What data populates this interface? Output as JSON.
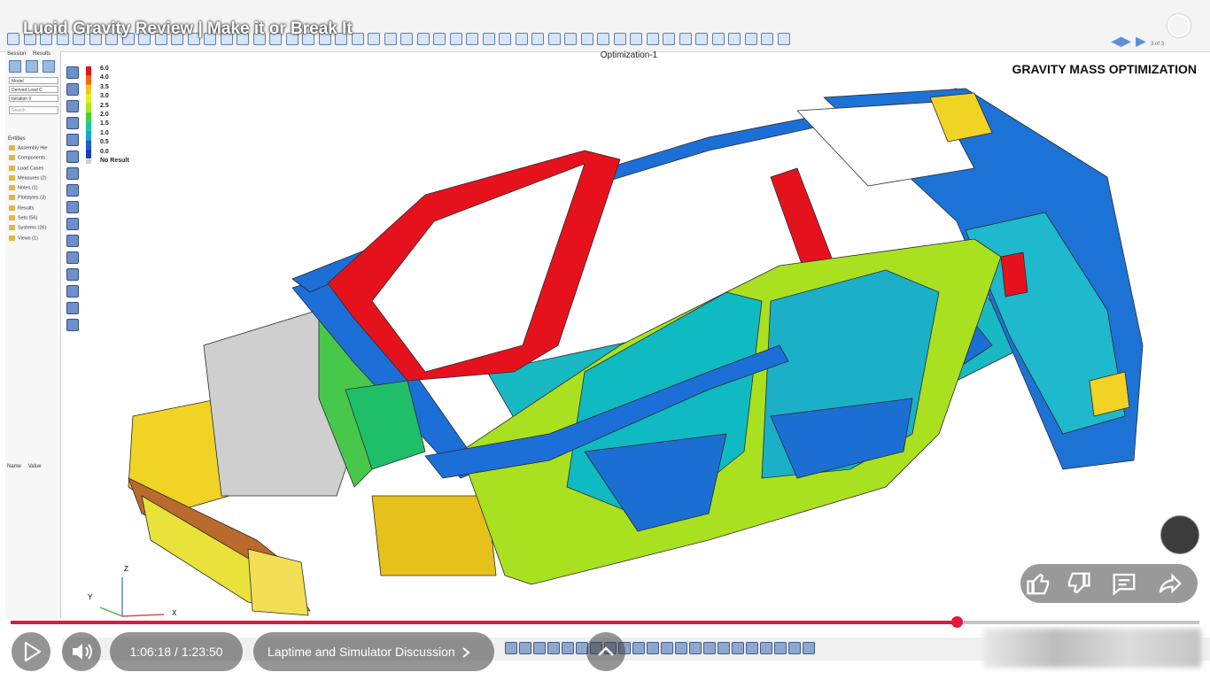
{
  "video": {
    "title": "Lucid Gravity Review | Make it or Break It",
    "current_time": "1:06:18",
    "time_separator": " / ",
    "duration": "1:23:50",
    "chapter": "Laptime and Simulator Discussion",
    "progress_fraction": 0.796,
    "accent_color": "#e4173b"
  },
  "app": {
    "viewport_title": "Optimization-1",
    "heading": "GRAVITY MASS OPTIMIZATION",
    "panel": {
      "tabs": [
        "Session",
        "Results"
      ],
      "dropdowns": [
        "Model",
        "Derived Load C",
        "Iteration 0"
      ],
      "search_placeholder": "Search",
      "entities_label": "Entities",
      "entities": [
        "Assembly Hie",
        "Components",
        "Load Cases",
        "Measures (2)",
        "Notes (1)",
        "Plotstyles (3)",
        "Results",
        "Sets (56)",
        "Systems (26)",
        "Views (1)"
      ],
      "name_header": "Name",
      "value_header": "Value"
    },
    "legend": {
      "values": [
        "6.0",
        "4.0",
        "3.5",
        "3.0",
        "2.5",
        "2.0",
        "1.5",
        "1.0",
        "0.5",
        "0.0"
      ],
      "colors": [
        "#e8121c",
        "#ee6a10",
        "#f2c11a",
        "#e8ea1c",
        "#aee524",
        "#46d233",
        "#19c8a0",
        "#1aa4dc",
        "#1c5fd0",
        "#1c3bb8"
      ],
      "no_result": "No Result"
    },
    "axes": {
      "x": "X",
      "y": "Y",
      "z": "Z"
    },
    "page_indicator": "3 of 3"
  },
  "icons": [
    "play-icon",
    "volume-icon",
    "chevron-right-icon",
    "chevron-up-icon",
    "thumbs-up-icon",
    "thumbs-down-icon",
    "comment-icon",
    "share-icon"
  ]
}
